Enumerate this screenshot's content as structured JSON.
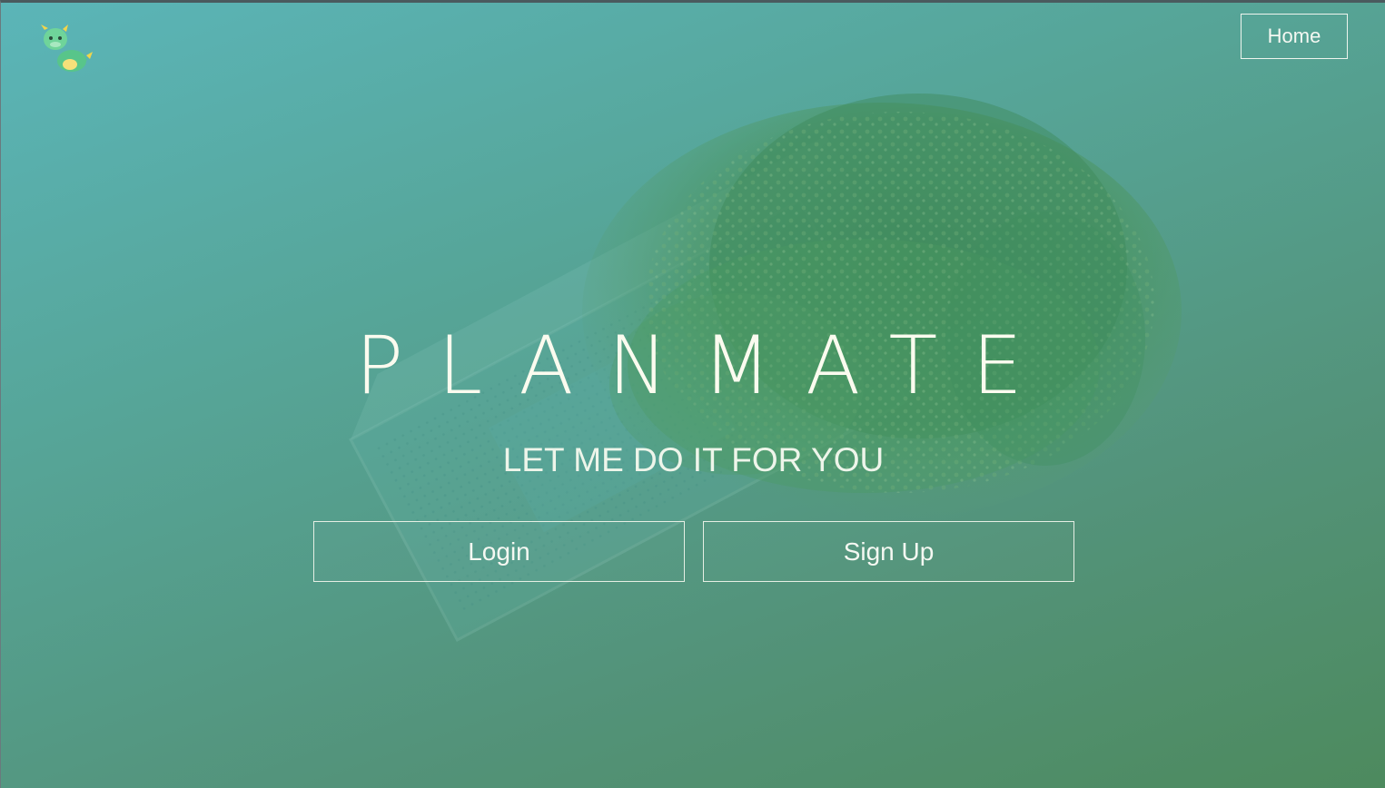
{
  "header": {
    "logo_icon": "dragon-mascot-icon",
    "home_label": "Home"
  },
  "hero": {
    "title": "PLANMATE",
    "subtitle": "LET ME DO IT FOR YOU",
    "illustration": "plant-growing-from-chip-icon"
  },
  "actions": {
    "login_label": "Login",
    "signup_label": "Sign Up"
  },
  "colors": {
    "gradient_start": "#5bb5b8",
    "gradient_end": "#4d8a5e",
    "text": "#fbfbef"
  }
}
